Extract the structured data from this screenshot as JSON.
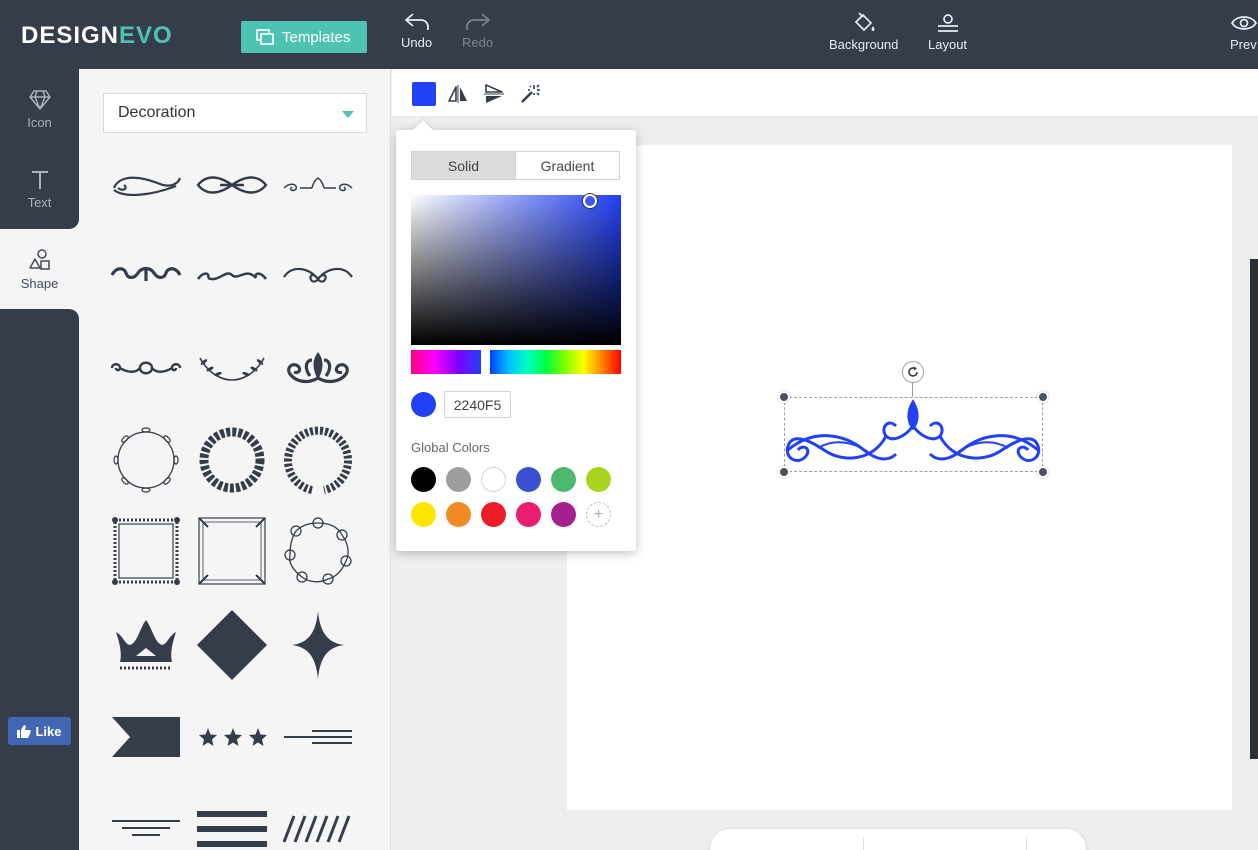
{
  "logo": {
    "part1": "DESIGN",
    "part2": "EVO"
  },
  "topbar": {
    "templates_label": "Templates",
    "undo_label": "Undo",
    "redo_label": "Redo",
    "background_label": "Background",
    "layout_label": "Layout",
    "preview_label": "Prev"
  },
  "rail": {
    "items": [
      {
        "label": "Icon",
        "icon": "diamond-icon"
      },
      {
        "label": "Text",
        "icon": "text-icon"
      },
      {
        "label": "Shape",
        "icon": "shapes-icon"
      }
    ],
    "like_label": "Like"
  },
  "panel": {
    "category": "Decoration",
    "shapes": [
      "flourish-1",
      "flourish-2",
      "flourish-3",
      "flourish-4",
      "flourish-5",
      "flourish-6",
      "flourish-7",
      "laurel-branch",
      "ornament-crest",
      "wreath-thin",
      "wreath-thick",
      "laurel-wreath",
      "frame-ornate",
      "frame-corners",
      "frame-scroll",
      "crown",
      "diamond",
      "four-point-star",
      "ribbon-banner",
      "three-stars",
      "lines-right",
      "lines-centered",
      "three-bars",
      "diagonal-lines"
    ]
  },
  "colors": {
    "accent": "#4fc3b1",
    "dark": "#353d4a",
    "selected": "#2240f5"
  },
  "picker": {
    "tab_solid": "Solid",
    "tab_gradient": "Gradient",
    "hex_value": "2240F5",
    "global_colors_label": "Global Colors",
    "global_colors": [
      "#000000",
      "#9e9e9e",
      "#ffffff",
      "#3a50d0",
      "#4cb86e",
      "#a6d41e",
      "#ffe600",
      "#f08a24",
      "#ee1c24",
      "#e91e73",
      "#a61f8e"
    ],
    "add_label": "+"
  }
}
